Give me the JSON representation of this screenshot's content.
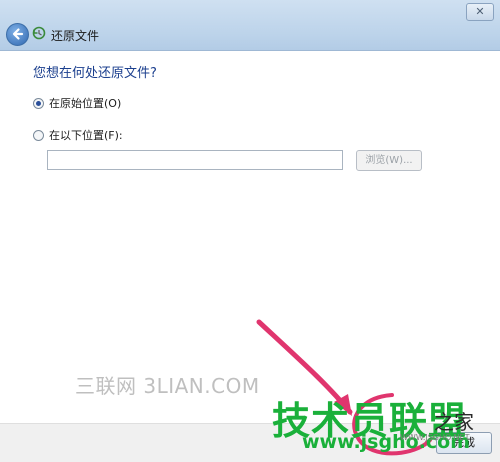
{
  "window": {
    "close_label": "✕",
    "title": "还原文件"
  },
  "main": {
    "question": "您想在何处还原文件?",
    "options": [
      {
        "label": "在原始位置(O)",
        "selected": true
      },
      {
        "label": "在以下位置(F):",
        "selected": false
      }
    ],
    "path_input": {
      "value": "",
      "placeholder": ""
    },
    "browse_label": "浏览(W)..."
  },
  "footer": {
    "finish_label": "完成"
  },
  "watermarks": {
    "sanlian": "三联网 3LIAN.COM",
    "jishu": "技术员联盟",
    "zhijia": "之家",
    "url": "www.jsgho.com",
    "url2": "WWW.JSGHO.NET"
  },
  "colors": {
    "title_bar": "#bcd3ea",
    "question_text": "#1b3f8e",
    "annotation_arrow": "#e0356e",
    "watermark_green": "#1ab03a"
  }
}
